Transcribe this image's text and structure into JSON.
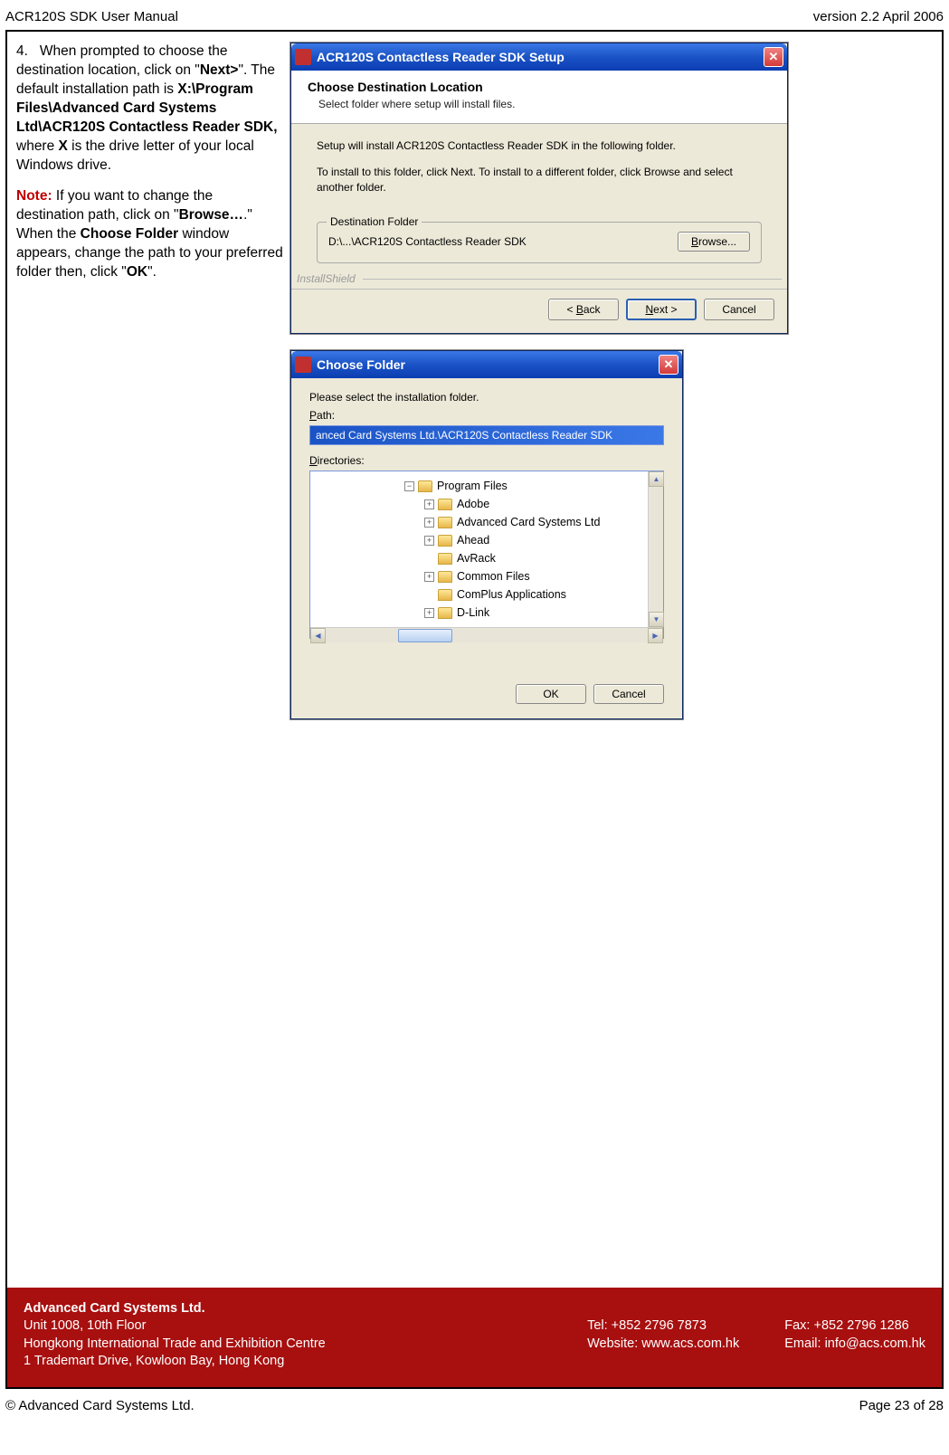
{
  "header": {
    "left": "ACR120S SDK User Manual",
    "right": "version 2.2 April 2006"
  },
  "instruction": {
    "step_no": "4.",
    "p1a": "When prompted to choose the destination location, click on \"",
    "next": "Next>",
    "p1b": "\". The default installation path is ",
    "path_bold": "X:\\Program Files\\Advanced Card Systems Ltd\\ACR120S Contactless Reader SDK,",
    "p1c": " where ",
    "x": "X",
    "p1d": " is the drive letter of your local Windows drive.",
    "note_label": "Note:",
    "p2a": " If you want to change the destination path, click on \"",
    "browse": "Browse…",
    "p2b": ".\" When the ",
    "choose_folder": "Choose Folder",
    "p2c": " window appears, change the path to your preferred folder then, click \"",
    "ok": "OK",
    "p2d": "\"."
  },
  "installer": {
    "title": "ACR120S Contactless Reader SDK Setup",
    "sub_title": "Choose Destination Location",
    "sub_desc": "Select folder where setup will install files.",
    "body1": "Setup will install ACR120S Contactless Reader SDK in the following folder.",
    "body2": "To install to this folder, click Next. To install to a different folder, click Browse and select another folder.",
    "dest_legend": "Destination Folder",
    "dest_path": "D:\\...\\ACR120S Contactless Reader SDK",
    "browse_btn": "Browse...",
    "install_shield": "InstallShield",
    "back_btn": "< Back",
    "next_btn": "Next >",
    "cancel_btn": "Cancel"
  },
  "choose_folder": {
    "title": "Choose Folder",
    "instr": "Please select the installation folder.",
    "path_label_pre": "P",
    "path_label_rest": "ath:",
    "path_value": "anced Card Systems Ltd.\\ACR120S Contactless Reader SDK",
    "dir_label_pre": "D",
    "dir_label_rest": "irectories:",
    "folders": [
      "Program Files",
      "Adobe",
      "Advanced Card Systems Ltd",
      "Ahead",
      "AvRack",
      "Common Files",
      "ComPlus Applications",
      "D-Link"
    ],
    "ok_btn": "OK",
    "cancel_btn": "Cancel"
  },
  "footer": {
    "company": "Advanced Card Systems Ltd.",
    "addr1": "Unit 1008, 10th Floor",
    "addr2": "Hongkong International Trade and Exhibition Centre",
    "addr3": "1 Trademart Drive, Kowloon Bay, Hong Kong",
    "tel": "Tel: +852 2796 7873",
    "website": "Website: www.acs.com.hk",
    "fax": "Fax: +852 2796 1286",
    "email": "Email: info@acs.com.hk"
  },
  "page_footer": {
    "left": "© Advanced Card Systems Ltd.",
    "right": "Page 23 of 28"
  }
}
